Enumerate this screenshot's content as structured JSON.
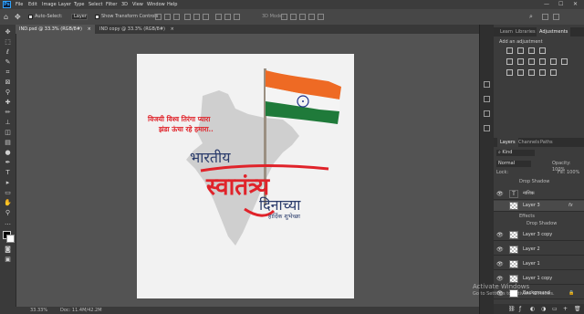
{
  "menubar": {
    "logo": "Ps",
    "menus": [
      "File",
      "Edit",
      "Image",
      "Layer",
      "Type",
      "Select",
      "Filter",
      "3D",
      "View",
      "Window",
      "Help"
    ],
    "window_buttons": [
      "—",
      "☐",
      "✕"
    ]
  },
  "options_bar": {
    "auto_select_label": "Auto-Select:",
    "auto_select_value": "Layer",
    "transform_label": "Show Transform Controls",
    "mode_label": "3D Mode:"
  },
  "tabs": [
    {
      "label": "IND.psd @ 33.3% (RGB/8#)",
      "close": "×",
      "active": true
    },
    {
      "label": "IND copy @ 33.3% (RGB/8#)",
      "close": "×",
      "active": false
    }
  ],
  "poster": {
    "slogan_line1": "विजयी विश्व तिरंगा प्यारा",
    "slogan_line2": "झंडा ऊंचा रहे हमारा..",
    "title_bharatiya": "भारतीय",
    "title_swatantrya": "स्वातंत्र्य",
    "title_dinachya": "दिनाच्या",
    "subtitle": "हार्दिक शुभेच्छा",
    "colors": {
      "saffron": "#e8542a",
      "red": "#e0232a",
      "navy": "#2a3b6b",
      "green": "#1f7a3a",
      "map": "#cfcfcf"
    }
  },
  "status": {
    "zoom": "33.33%",
    "doc": "Doc: 11.4M/42.2M"
  },
  "right_panel": {
    "top_tabs": [
      "Learn",
      "Libraries",
      "Adjustments"
    ],
    "add_adjustment": "Add an adjustment",
    "layer_tabs": [
      "Layers",
      "Channels",
      "Paths"
    ],
    "kind_label": "Kind",
    "blend_mode": "Normal",
    "opacity_label": "Opacity: 100%",
    "lock_label": "Lock:",
    "fill_label": "Fill: 100%",
    "layers": [
      {
        "name": "",
        "sub": "Drop Shadow",
        "thumb": "text"
      },
      {
        "name": "नाशिक",
        "thumb": "text",
        "visible": true
      },
      {
        "name": "Layer 3",
        "thumb": "image",
        "visible": false,
        "fx": "fx",
        "effects": [
          "Effects",
          "Drop Shadow"
        ]
      },
      {
        "name": "Layer 3 copy",
        "thumb": "image",
        "visible": true
      },
      {
        "name": "Layer 2",
        "thumb": "image",
        "visible": true
      },
      {
        "name": "Layer 1",
        "thumb": "image",
        "visible": true
      },
      {
        "name": "Layer 1 copy",
        "thumb": "image",
        "visible": true
      },
      {
        "name": "Background",
        "thumb": "white",
        "visible": true
      }
    ]
  },
  "watermark": {
    "line1": "Activate Windows",
    "line2": "Go to Settings to activate Windows."
  }
}
